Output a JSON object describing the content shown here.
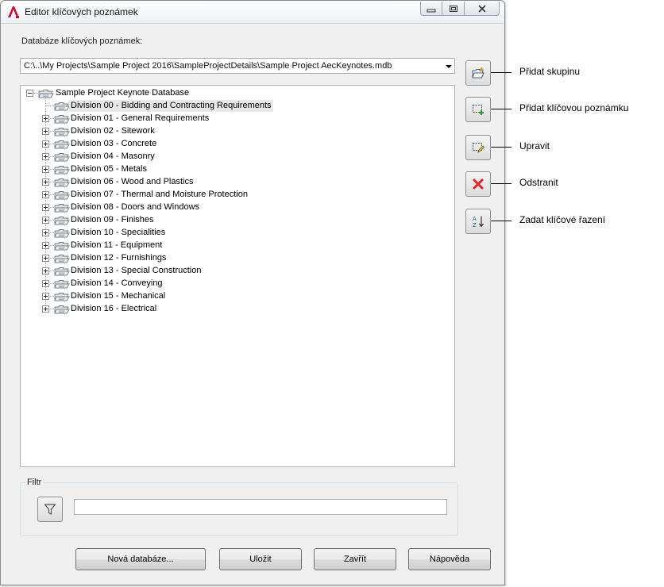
{
  "window": {
    "title": "Editor klíčových poznámek"
  },
  "database": {
    "label": "Databáze klíčových poznámek:",
    "path": "C:\\..\\My Projects\\Sample Project 2016\\SampleProjectDetails\\Sample Project AecKeynotes.mdb"
  },
  "tree": {
    "root": "Sample Project Keynote Database",
    "items": [
      {
        "label": "Division 00 - Bidding and Contracting Requirements",
        "expandable": false,
        "selected": true
      },
      {
        "label": "Division 01 - General Requirements",
        "expandable": true
      },
      {
        "label": "Division 02 - Sitework",
        "expandable": true
      },
      {
        "label": "Division 03 - Concrete",
        "expandable": true
      },
      {
        "label": "Division 04 - Masonry",
        "expandable": true
      },
      {
        "label": "Division 05 - Metals",
        "expandable": true
      },
      {
        "label": "Division 06 - Wood and Plastics",
        "expandable": true
      },
      {
        "label": "Division 07 - Thermal and Moisture Protection",
        "expandable": true
      },
      {
        "label": "Division 08 - Doors and Windows",
        "expandable": true
      },
      {
        "label": "Division 09 - Finishes",
        "expandable": true
      },
      {
        "label": "Division 10 - Specialities",
        "expandable": true
      },
      {
        "label": "Division 11 - Equipment",
        "expandable": true
      },
      {
        "label": "Division 12 - Furnishings",
        "expandable": true
      },
      {
        "label": "Division 13 - Special Construction",
        "expandable": true
      },
      {
        "label": "Division 14 - Conveying",
        "expandable": true
      },
      {
        "label": "Division 15 - Mechanical",
        "expandable": true
      },
      {
        "label": "Division 16 - Electrical",
        "expandable": true
      }
    ]
  },
  "side_actions": [
    {
      "icon": "folder-add-icon",
      "callout": "Přidat skupinu"
    },
    {
      "icon": "keynote-add-icon",
      "callout": "Přidat klíčovou poznámku"
    },
    {
      "icon": "edit-icon",
      "callout": "Upravit"
    },
    {
      "icon": "delete-icon",
      "callout": "Odstranit",
      "color": "#e02424"
    },
    {
      "icon": "sort-icon",
      "callout": "Zadat klíčové řazení"
    }
  ],
  "filter": {
    "label": "Filtr",
    "value": ""
  },
  "buttons": {
    "new_db": "Nová databáze...",
    "save": "Uložit",
    "close": "Zavřít",
    "help": "Nápověda"
  }
}
